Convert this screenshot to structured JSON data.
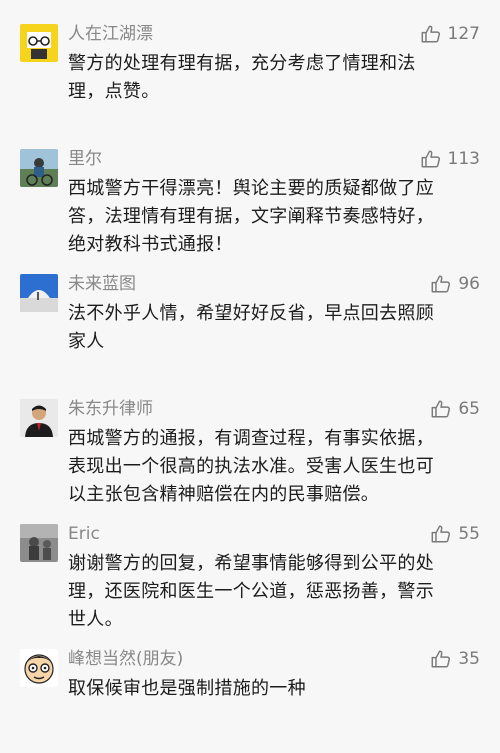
{
  "comments": [
    {
      "name": "人在江湖漂",
      "likes": "127",
      "avatar": "cartoon-glasses-avatar",
      "lines": [
        "警方的处理有理有据，充分考虑了情理和法",
        "理，点赞。"
      ]
    },
    {
      "name": "里尔",
      "likes": "113",
      "avatar": "cyclist-photo-avatar",
      "lines": [
        "西城警方干得漂亮！舆论主要的质疑都做了应",
        "答，法理情有理有据，文字阐释节奏感特好，",
        "绝对教科书式通报！"
      ]
    },
    {
      "name": "未来蓝图",
      "likes": "96",
      "avatar": "blue-sky-building-avatar",
      "lines": [
        "法不外乎人情，希望好好反省，早点回去照顾",
        "家人"
      ]
    },
    {
      "name": "朱东升律师",
      "likes": "65",
      "avatar": "lawyer-portrait-avatar",
      "lines": [
        "西城警方的通报，有调查过程，有事实依据，",
        "表现出一个很高的执法水准。受害人医生也可",
        "以主张包含精神赔偿在内的民事赔偿。"
      ]
    },
    {
      "name": "Eric",
      "likes": "55",
      "avatar": "gray-photo-avatar",
      "lines": [
        "谢谢警方的回复，希望事情能够得到公平的处",
        "理，还医院和医生一个公道，惩恶扬善，警示",
        "世人。"
      ]
    },
    {
      "name": "峰想当然(朋友)",
      "likes": "35",
      "avatar": "cartoon-face-avatar",
      "lines": [
        "取保候审也是强制措施的一种"
      ]
    }
  ]
}
